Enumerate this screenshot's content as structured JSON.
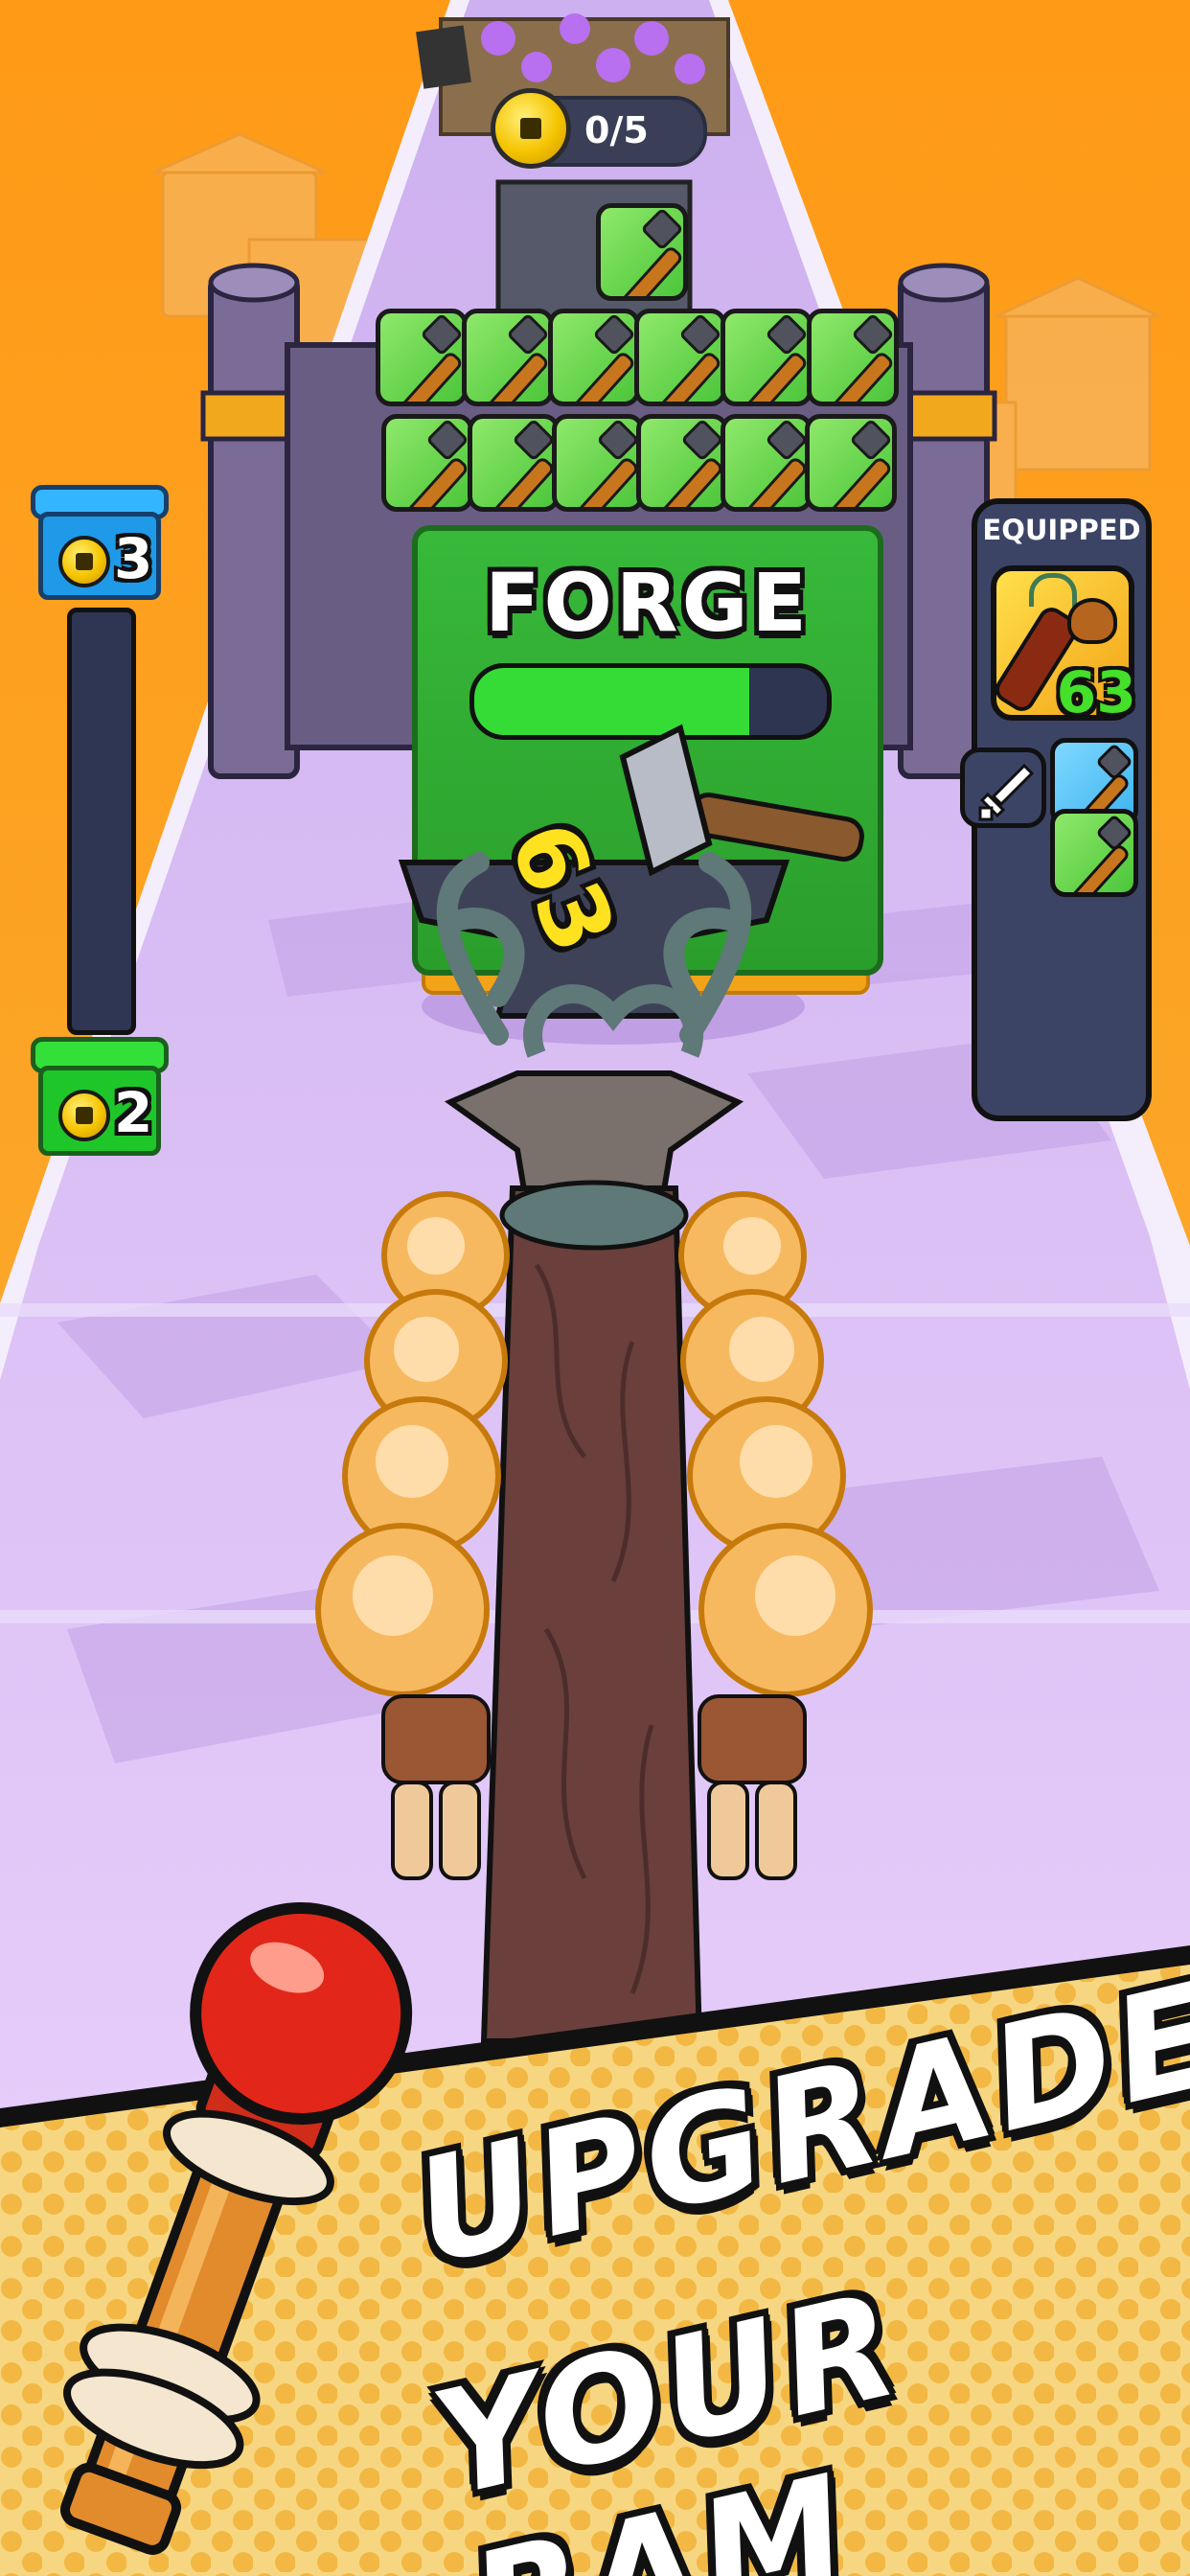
{
  "hud": {
    "coin_progress": "0/5",
    "gauge_top_value": "3",
    "gauge_bottom_value": "2"
  },
  "forge": {
    "label": "FORGE",
    "progress_fraction": 0.78,
    "damage_number": "63"
  },
  "equipped": {
    "title": "EQUIPPED",
    "ram_level": "63",
    "weapon_slots": [
      "axe-icon",
      "hammer-icon"
    ],
    "tab_icon": "sword-icon"
  },
  "banner": {
    "line1": "UPGRADE",
    "line2": "YOUR RAM"
  },
  "colors": {
    "sky": "#f5a11e",
    "track": "#d9b6f1",
    "forge_green": "#2fae31",
    "progress_green": "#36dc36",
    "panel_navy": "#3c4466",
    "banner_yellow": "#f6d277"
  }
}
